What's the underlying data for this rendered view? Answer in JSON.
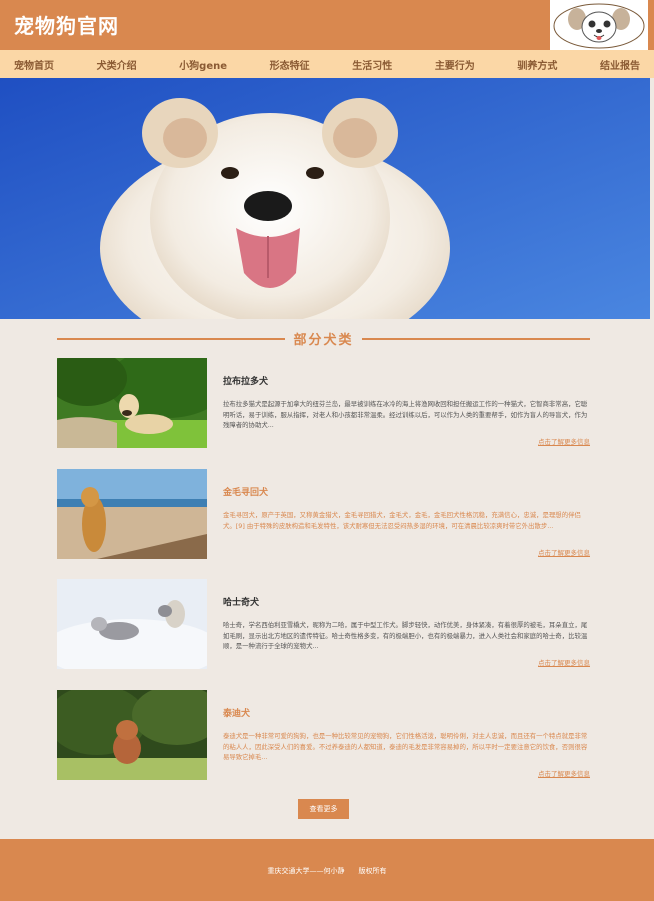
{
  "header": {
    "logo_text": "宠物狗官网"
  },
  "nav": {
    "items": [
      "宠物首页",
      "犬类介绍",
      "小狗gene",
      "形态特征",
      "生活习性",
      "主要行为",
      "驯养方式",
      "结业报告"
    ]
  },
  "section": {
    "title": "部分犬类"
  },
  "cards": [
    {
      "name": "拉布拉多犬",
      "desc": "拉布拉多猫犬是起源于加拿大的纽芬兰岛，最早被训练在冰冷的海上将渔网收回和担任搬运工作的一种猫犬，它智商非常高，它聪明听话，易于训练，服从指挥，对老人和小孩都非常温柔。经过训练以后，可以作为人类的重要帮手，如作为盲人的导盲犬，作为残障者的协助犬...",
      "more": "点击了解更多信息"
    },
    {
      "name": "金毛寻回犬",
      "desc": "金毛寻回犬，原产于英国，又称黄金猎犬，金毛寻回猎犬，金毛犬，金毛，金毛回犬性格沉稳，充满信心，忠诚，是理想的伴侣犬。[9] 由于特殊的皮肤构造和毛发特性，该犬耐寒但无法忍受闷热多湿的环境，可在清晨比较凉爽时带它外出散步...",
      "more": "点击了解更多信息"
    },
    {
      "name": "哈士奇犬",
      "desc": "哈士奇，学名西伯利亚雪橇犬，昵称为二哈，属于中型工作犬。脚步轻快，动作优美，身体紧凑，有着很厚的被毛，耳朵直立，尾如毛刷，显示出北方地区的遗传特征。哈士奇性格多变，有的极端胆小，也有的极端暴力，进入人类社会和家庭的哈士奇，比较温顺，是一种流行于全球的宠物犬...",
      "more": "点击了解更多信息"
    },
    {
      "name": "泰迪犬",
      "desc": "泰迪犬是一种非常可爱的狗狗，也是一种比较常见的宠物狗，它们性格活泼，聪明伶俐，对主人忠诚，而且还有一个特点就是非常的粘人人，因此深受人们的喜爱。不过养泰迪的人都知道，泰迪的毛发是非常容易掉的，所以平时一定要注意它的饮食，否则很容易导致它掉毛...",
      "more": "点击了解更多信息"
    }
  ],
  "view_more": "查看更多",
  "footer": {
    "text": "重庆交通大学——何小静　　版权所有"
  },
  "colors": {
    "accent": "#d9884f",
    "nav_bg": "#fbd7a6",
    "page_bg": "#efe9e3"
  }
}
